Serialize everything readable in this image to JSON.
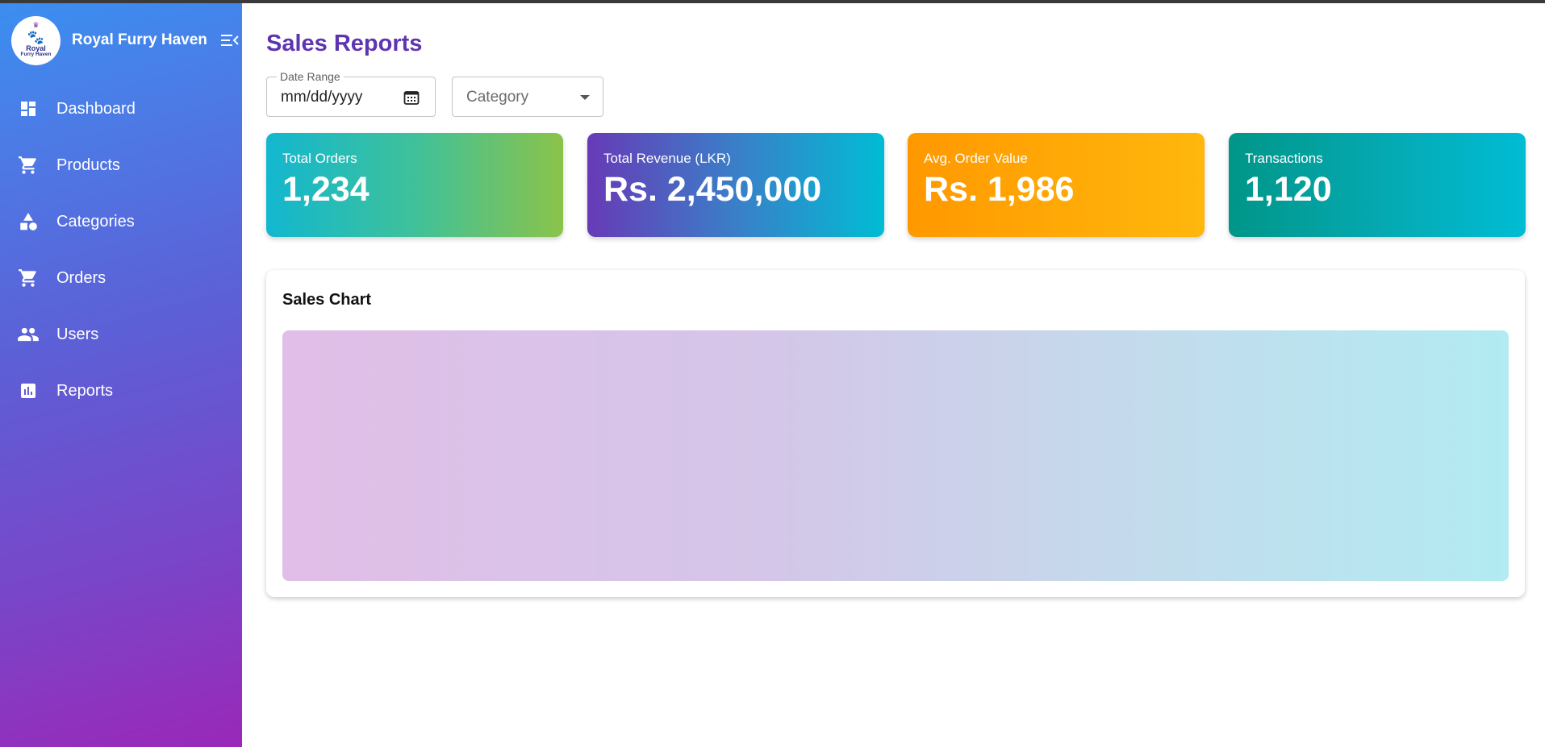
{
  "app": {
    "brand_name": "Royal Furry Haven",
    "logo_text_line1": "Royal",
    "logo_text_line2": "Furry Haven"
  },
  "sidebar": {
    "items": [
      {
        "label": "Dashboard",
        "icon": "dashboard-icon"
      },
      {
        "label": "Products",
        "icon": "cart-icon"
      },
      {
        "label": "Categories",
        "icon": "category-shapes-icon"
      },
      {
        "label": "Orders",
        "icon": "cart-icon"
      },
      {
        "label": "Users",
        "icon": "people-icon"
      },
      {
        "label": "Reports",
        "icon": "bar-chart-icon"
      }
    ]
  },
  "page": {
    "title": "Sales Reports"
  },
  "filters": {
    "date_label": "Date Range",
    "date_placeholder": "mm/dd/yyyy",
    "category_placeholder": "Category"
  },
  "stats": [
    {
      "title": "Total Orders",
      "value": "1,234"
    },
    {
      "title": "Total Revenue (LKR)",
      "value": "Rs. 2,450,000"
    },
    {
      "title": "Avg. Order Value",
      "value": "Rs. 1,986"
    },
    {
      "title": "Transactions",
      "value": "1,120"
    }
  ],
  "chart": {
    "title": "Sales Chart"
  },
  "colors": {
    "title_purple": "#5e35b1",
    "sidebar_top": "#3a8ff0",
    "sidebar_bottom": "#9a28b8"
  }
}
